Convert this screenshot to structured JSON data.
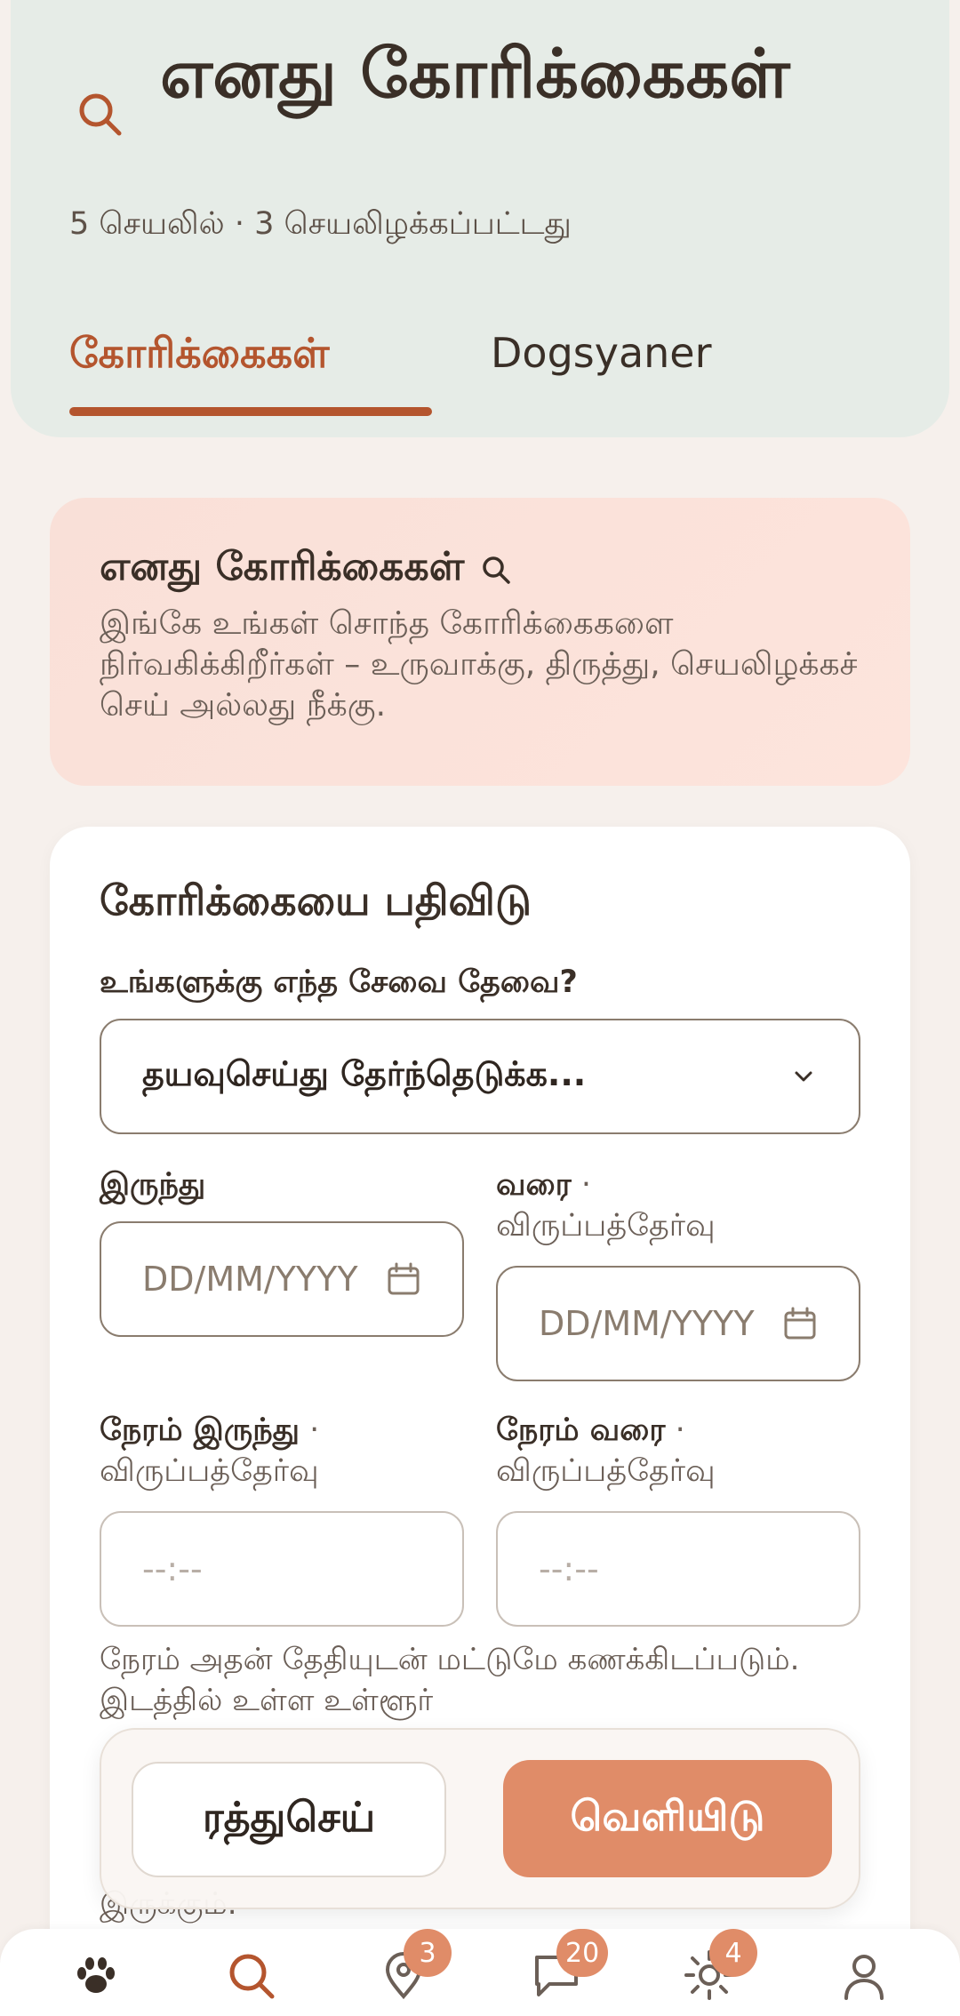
{
  "header": {
    "title": "எனது கோரிக்கைகள்",
    "subtitle": "5 செயலில் · 3 செயலிழக்கப்பட்டது",
    "tabs": [
      {
        "label": "கோரிக்கைகள்",
        "active": true
      },
      {
        "label": "Dogsyaner",
        "active": false
      }
    ]
  },
  "info": {
    "title": "எனது கோரிக்கைகள்",
    "text": "இங்கே உங்கள் சொந்த கோரிக்கைகளை நிர்வகிக்கிறீர்கள் – உருவாக்கு, திருத்து, செயலிழக்கச் செய் அல்லது நீக்கு."
  },
  "form": {
    "title": "கோரிக்கையை பதிவிடு",
    "service_label": "உங்களுக்கு எந்த சேவை தேவை?",
    "service_value": "தயவுசெய்து தேர்ந்தெடுக்க...",
    "from_label": "இருந்து",
    "to_label": "வரை",
    "optional": "விருப்பத்தேர்வு",
    "date_placeholder": "DD/MM/YYYY",
    "time_from_label": "நேரம் இருந்து",
    "time_to_label": "நேரம் வரை",
    "time_placeholder": "--:--",
    "helper": "நேரம் அதன் தேதியுடன் மட்டுமே கணக்கிடப்படும். இடத்தில் உள்ள உள்ளூர்",
    "helper_tail": "இருக்கும்."
  },
  "actions": {
    "cancel": "ரத்துசெய்",
    "publish": "வெளியிடு"
  },
  "nav": {
    "badges": {
      "location": "3",
      "messages": "20",
      "sun": "4"
    }
  },
  "colors": {
    "accent": "#b4552e",
    "button": "#e08c68",
    "header_bg": "#e6ece7"
  }
}
